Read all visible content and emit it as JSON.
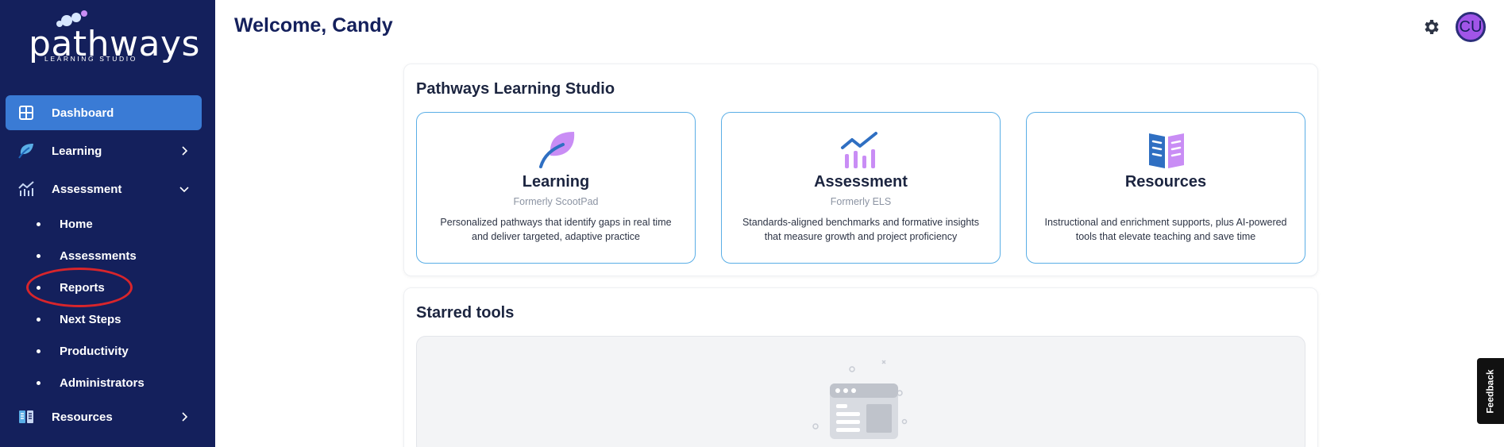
{
  "app": {
    "logo_word": "pathways",
    "logo_subtitle": "LEARNING STUDIO"
  },
  "sidebar": {
    "items": [
      {
        "label": "Dashboard",
        "icon": "dashboard-grid-icon",
        "active": true
      },
      {
        "label": "Learning",
        "icon": "leaf-icon",
        "chevron": "chevron-right-icon"
      },
      {
        "label": "Assessment",
        "icon": "chart-icon",
        "chevron": "chevron-down-icon"
      },
      {
        "label": "Resources",
        "icon": "book-icon",
        "chevron": "chevron-right-icon"
      }
    ],
    "assessment_subitems": [
      "Home",
      "Assessments",
      "Reports",
      "Next Steps",
      "Productivity",
      "Administrators"
    ]
  },
  "header": {
    "title": "Welcome, Candy",
    "avatar_initials": "CU",
    "settings_icon": "gear-icon"
  },
  "studio": {
    "title": "Pathways Learning Studio",
    "tiles": [
      {
        "title": "Learning",
        "subtitle": "Formerly ScootPad",
        "description": "Personalized pathways that identify gaps in real time and deliver targeted, adaptive practice",
        "icon": "leaf-icon"
      },
      {
        "title": "Assessment",
        "subtitle": "Formerly ELS",
        "description": "Standards-aligned benchmarks and formative insights that measure growth and project proficiency",
        "icon": "chart-icon"
      },
      {
        "title": "Resources",
        "subtitle": "",
        "description": "Instructional and enrichment supports, plus AI-powered tools that elevate teaching and save time",
        "icon": "book-icon"
      }
    ]
  },
  "starred": {
    "title": "Starred tools",
    "empty_icon": "browser-window-icon"
  },
  "feedback_label": "Feedback",
  "colors": {
    "sidebar_bg": "#14205c",
    "active_item": "#3a7bd5",
    "tile_border": "#5aaee6",
    "accent_purple": "#c98df5",
    "accent_blue": "#2f6fc2",
    "annotation_red": "#d8252b"
  }
}
